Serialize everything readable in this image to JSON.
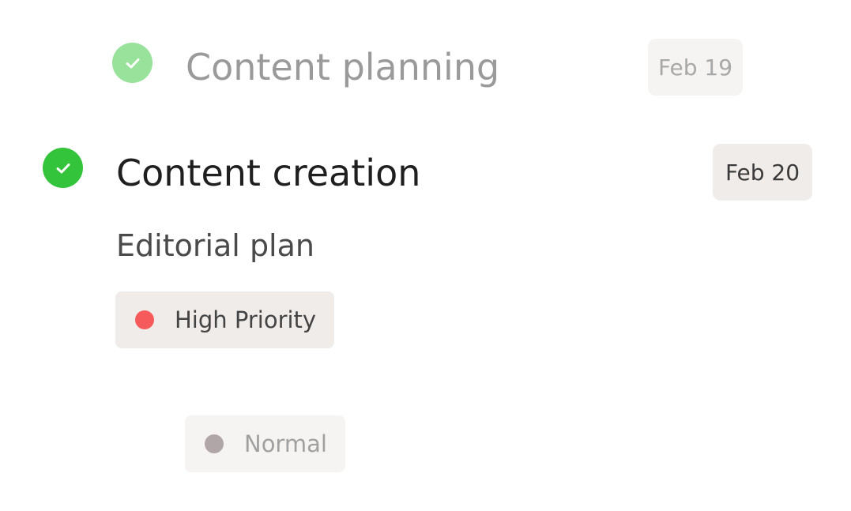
{
  "tasks": [
    {
      "title": "Content planning",
      "due_date": "Feb 19",
      "completed": true,
      "state": "faded",
      "check_color": "#98e29c",
      "title_color": "#9a9a9a",
      "chip_bg": "#f6f4f2"
    },
    {
      "title": "Content creation",
      "due_date": "Feb 20",
      "completed": true,
      "state": "active",
      "check_color": "#33c43b",
      "title_color": "#1f1f1f",
      "chip_bg": "#f0ecea"
    }
  ],
  "subtask": {
    "title": "Editorial plan"
  },
  "priority_tags": [
    {
      "label": "High Priority",
      "dot_color": "#f65a5a",
      "background": "#f0ecea",
      "text_color": "#444444",
      "state": "active"
    },
    {
      "label": "Normal",
      "dot_color": "#b0a6a8",
      "background": "#f6f4f2",
      "text_color": "#a0a0a0",
      "state": "faded"
    }
  ],
  "icons": {
    "check": "check-icon",
    "priority_dot": "dot-icon"
  }
}
